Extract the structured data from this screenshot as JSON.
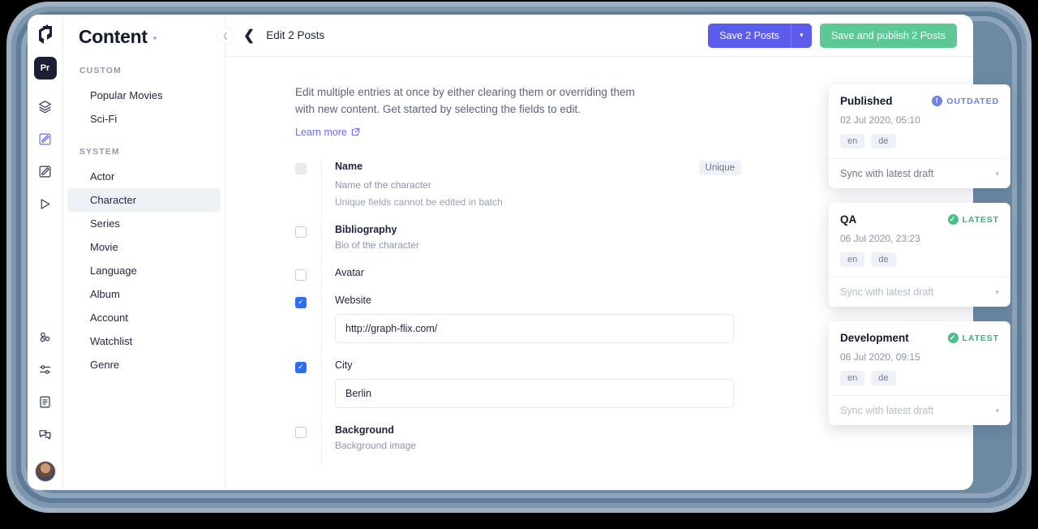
{
  "rail": {
    "logo_icon": "graphcms-logo-icon",
    "project_badge": "Pr",
    "icons": [
      {
        "name": "layers-icon",
        "active": false
      },
      {
        "name": "content-edit-icon",
        "active": true
      },
      {
        "name": "schema-edit-icon",
        "active": false
      },
      {
        "name": "play-icon",
        "active": false
      },
      {
        "name": "webhooks-icon",
        "active": false
      },
      {
        "name": "settings-sliders-icon",
        "active": false
      },
      {
        "name": "document-icon",
        "active": false
      },
      {
        "name": "chat-icon",
        "active": false
      }
    ],
    "avatar": "user-avatar"
  },
  "sidebar": {
    "title": "Content",
    "groups": [
      {
        "label": "CUSTOM",
        "items": [
          {
            "label": "Popular Movies",
            "active": false
          },
          {
            "label": "Sci-Fi",
            "active": false
          }
        ]
      },
      {
        "label": "SYSTEM",
        "items": [
          {
            "label": "Actor",
            "active": false
          },
          {
            "label": "Character",
            "active": true
          },
          {
            "label": "Series",
            "active": false
          },
          {
            "label": "Movie",
            "active": false
          },
          {
            "label": "Language",
            "active": false
          },
          {
            "label": "Album",
            "active": false
          },
          {
            "label": "Account",
            "active": false
          },
          {
            "label": "Watchlist",
            "active": false
          },
          {
            "label": "Genre",
            "active": false
          }
        ]
      }
    ]
  },
  "topbar": {
    "back_icon": "back-chevron-icon",
    "collapse_icon": "collapse-sidebar-icon",
    "title": "Edit 2 Posts",
    "save_label": "Save 2 Posts",
    "save_caret_icon": "chevron-down-icon",
    "publish_label": "Save and publish 2 Posts",
    "save_color": "#5b5bec",
    "publish_color": "#5cc896"
  },
  "intro": {
    "text": "Edit multiple entries at once by either clearing them or overriding them with new content. Get started by selecting the fields to edit.",
    "learn_more": "Learn more",
    "external_icon": "external-link-icon"
  },
  "fields": [
    {
      "label": "Name",
      "description": "Name of the character",
      "note": "Unique fields cannot be edited in batch",
      "checked": false,
      "disabled": true,
      "badge": "Unique",
      "bold": true
    },
    {
      "label": "Bibliography",
      "description": "Bio of the character",
      "checked": false,
      "disabled": false,
      "bold": true
    },
    {
      "label": "Avatar",
      "checked": false,
      "disabled": false,
      "bold": false
    },
    {
      "label": "Website",
      "checked": true,
      "disabled": false,
      "bold": false,
      "value": "http://graph-flix.com/"
    },
    {
      "label": "City",
      "checked": true,
      "disabled": false,
      "bold": false,
      "value": "Berlin"
    },
    {
      "label": "Background",
      "description": "Background image",
      "checked": false,
      "disabled": false,
      "bold": true
    }
  ],
  "stages": [
    {
      "name": "Published",
      "status": "OUTDATED",
      "status_kind": "outdated",
      "status_icon": "info-circle-icon",
      "status_color": "#6b82e8",
      "date": "02 Jul 2020, 05:10",
      "locales": [
        "en",
        "de"
      ],
      "sync_label": "Sync with latest draft",
      "sync_muted": false,
      "sync_caret_icon": "chevron-down-icon"
    },
    {
      "name": "QA",
      "status": "LATEST",
      "status_kind": "latest",
      "status_icon": "check-circle-icon",
      "status_color": "#4cbe8a",
      "date": "06 Jul 2020, 23:23",
      "locales": [
        "en",
        "de"
      ],
      "sync_label": "Sync with latest draft",
      "sync_muted": true,
      "sync_caret_icon": "chevron-down-icon"
    },
    {
      "name": "Development",
      "status": "LATEST",
      "status_kind": "latest",
      "status_icon": "check-circle-icon",
      "status_color": "#4cbe8a",
      "date": "06 Jul 2020, 09:15",
      "locales": [
        "en",
        "de"
      ],
      "sync_label": "Sync with latest draft",
      "sync_muted": true,
      "sync_caret_icon": "chevron-down-icon"
    }
  ]
}
